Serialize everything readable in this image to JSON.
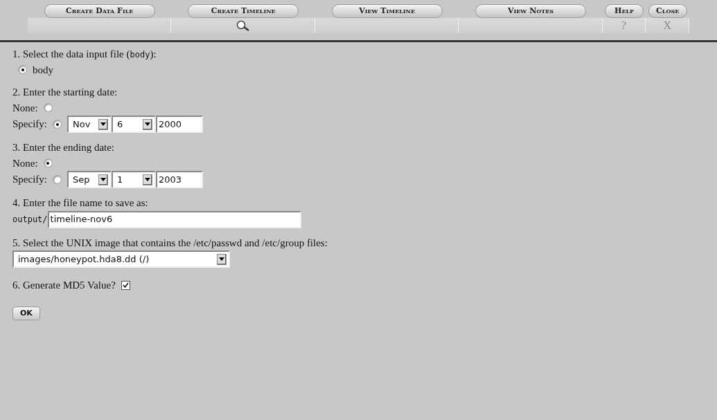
{
  "toolbar": {
    "buttons": [
      {
        "label": "Create Data File"
      },
      {
        "label": "Create Timeline",
        "kind": "search"
      },
      {
        "label": "View Timeline"
      },
      {
        "label": "View Notes"
      },
      {
        "label": "Help",
        "kind": "text",
        "sub": "?"
      },
      {
        "label": "Close",
        "kind": "text",
        "sub": "X"
      }
    ]
  },
  "step1": {
    "prefix": "1. Select the data input file (",
    "code": "body",
    "suffix": "):",
    "options": [
      {
        "label": "body",
        "selected": true
      }
    ]
  },
  "step2": {
    "title": "2. Enter the starting date:",
    "none": {
      "label": "None:",
      "selected": false
    },
    "specify": {
      "label": "Specify:",
      "selected": true
    },
    "month": "Nov",
    "day": "6",
    "year": "2000"
  },
  "step3": {
    "title": "3. Enter the ending date:",
    "none": {
      "label": "None:",
      "selected": true
    },
    "specify": {
      "label": "Specify:",
      "selected": false
    },
    "month": "Sep",
    "day": "1",
    "year": "2003"
  },
  "step4": {
    "title": "4. Enter the file name to save as:",
    "prefix": "output/",
    "value": "timeline-nov6"
  },
  "step5": {
    "title": "5. Select the UNIX image that contains the /etc/passwd and /etc/group files:",
    "value": "images/honeypot.hda8.dd (/)"
  },
  "step6": {
    "title": "6. Generate MD5 Value?",
    "checked": true
  },
  "ok_button": "OK"
}
